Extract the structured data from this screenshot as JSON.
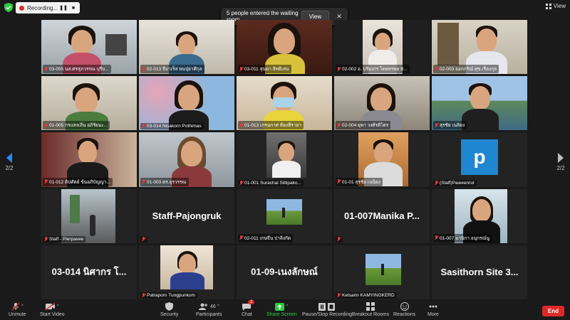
{
  "topbar": {
    "recording_label": "Recording...",
    "pause_icon": "pause-icon",
    "stop_icon": "stop-icon",
    "view_label": "View"
  },
  "notification": {
    "text": "5 people entered the waiting room",
    "button": "View"
  },
  "pager": {
    "left": "2/2",
    "right": "2/2"
  },
  "tiles": [
    {
      "label": "03-055 นส.ศรสุภวรรณ บุรีบ..."
    },
    {
      "label": "02-013 จีมาเร็ส พ่นปุ่ยาศิกุล"
    },
    {
      "label": "03-011 สุนดา สิทธิเสน"
    },
    {
      "label": "02-002 อ. บริมเกร โดยทรพย B..."
    },
    {
      "label": "02-003 ออกกริณ์ ศุข.เรืองกุล"
    },
    {
      "label": "01-005 กรแสงเลิ่น อภิรัยนะ..."
    },
    {
      "label": "03-014 Nisakorn Pothimas"
    },
    {
      "label": "01-013 เกรนกาศ ห้องทีรายา"
    },
    {
      "label": "02-004 ยุพา วงศ์รติไตร"
    },
    {
      "label": "สุรชัย เนลิยง"
    },
    {
      "label": "01-012 ดิปศัตย์ ข้นอภิบัญญา..."
    },
    {
      "label": "01-003 ดร.ยุรวรรณ"
    },
    {
      "label": "01-001 Surachai Sittipako..."
    },
    {
      "label": "01-01 สุรชัย เนนิยง"
    },
    {
      "label": "(Staff)Paweenrut"
    },
    {
      "label": "Staff - Pierpavee"
    },
    {
      "label": "Staff-Pajongruk"
    },
    {
      "label": "02-011 เกษจีน ปาลิงกัด"
    },
    {
      "label": "01-007Manika P..."
    },
    {
      "label": "01-007 มานิกา อนุกรณ์นู"
    },
    {
      "label": "03-014 นิศากร โ..."
    },
    {
      "label": "Patraporn Tungpunkom"
    },
    {
      "label": "01-09-เนงลักษณ์"
    },
    {
      "label": "Ketsarin KAMYINGKERD"
    },
    {
      "label": "Sasithorn Site 3..."
    }
  ],
  "toolbar": {
    "unmute": "Unmute",
    "start_video": "Start Video",
    "security": "Security",
    "participants": "Participants",
    "participants_count": "46",
    "chat": "Chat",
    "chat_badge": "2",
    "share_screen": "Share Screen",
    "pause_recording": "Pause/Stop Recording",
    "breakout": "Breakout Rooms",
    "reactions": "Reactions",
    "more": "More",
    "end": "End"
  },
  "colors": {
    "accent_blue": "#1e90ff",
    "share_green": "#2ecc40",
    "end_red": "#e02828",
    "background": "#1a1a1a",
    "tile": "#232323"
  }
}
